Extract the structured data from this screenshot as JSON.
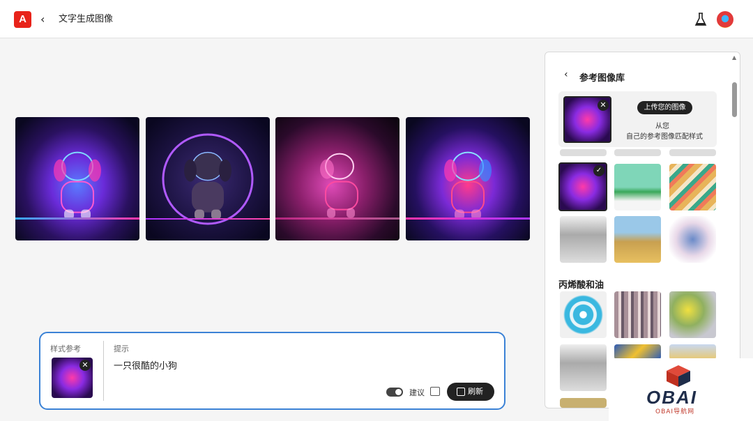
{
  "header": {
    "logo": "A",
    "title": "文字生成图像"
  },
  "panel": {
    "title": "参考图像库",
    "upload_button": "上传您的图像",
    "upload_line1": "从您",
    "upload_line2": "自己的参考图像匹配样式",
    "section_title": "丙烯酸和油"
  },
  "prompt": {
    "style_label": "样式参考",
    "hint_label": "提示",
    "hint_text": "一只很酷的小狗",
    "suggest_label": "建议",
    "refresh_label": "刷新"
  },
  "watermark": {
    "big": "OBAI",
    "small": "OBAI导航网"
  },
  "icons": {
    "back": "chevron-left-icon",
    "flask": "flask-icon",
    "close": "close-icon",
    "check": "check-icon"
  }
}
